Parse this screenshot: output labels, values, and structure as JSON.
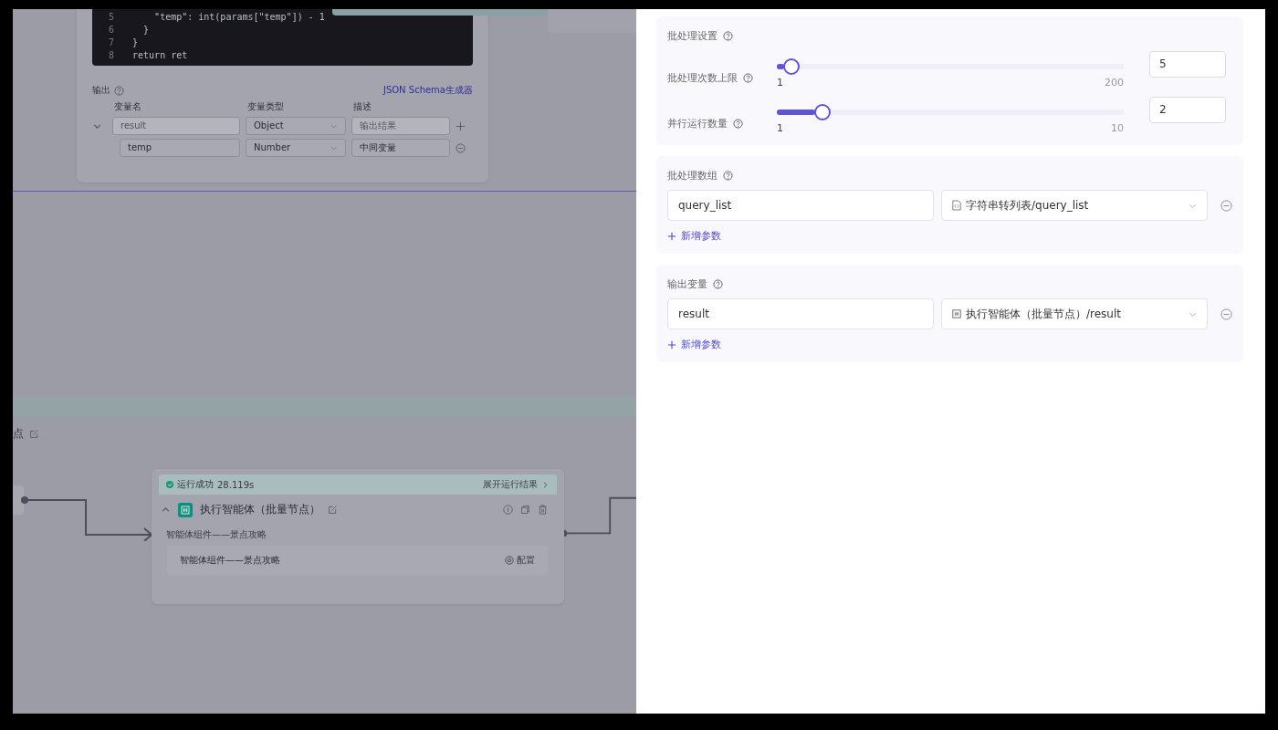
{
  "canvas": {
    "code_node": {
      "code_lines": [
        {
          "number": "5",
          "text": "      \"temp\": int(params[\"temp\"]) - 1"
        },
        {
          "number": "6",
          "text": "    }"
        },
        {
          "number": "7",
          "text": "  }"
        },
        {
          "number": "8",
          "text": "  return ret"
        }
      ],
      "output": {
        "label": "输出",
        "schema_link": "JSON Schema生成器",
        "columns": [
          "变量名",
          "变量类型",
          "描述"
        ],
        "rows": [
          {
            "kind": "object",
            "expanded": true,
            "disabled": true,
            "name": "result",
            "type": "Object",
            "description": "输出结果"
          },
          {
            "kind": "field",
            "disabled": false,
            "name": "temp",
            "type": "Number",
            "description": "中间变量"
          }
        ]
      }
    },
    "prev_node_title": "点",
    "batch_node": {
      "status": "运行成功",
      "time": "28.119s",
      "expand_link": "展开运行结果",
      "title": "执行智能体（批量节点）",
      "subtitle": "智能体组件——景点攻略",
      "component": {
        "name": "智能体组件——景点攻略",
        "action": "配置"
      }
    }
  },
  "panel": {
    "batch_settings": {
      "title": "批处理设置",
      "sliders": [
        {
          "label": "批处理次数上限",
          "level": 0.02,
          "min": "1",
          "max": "200",
          "value": "5"
        },
        {
          "label": "并行运行数量",
          "level": 0.11,
          "min": "1",
          "max": "10",
          "value": "2"
        }
      ]
    },
    "param_sections": [
      {
        "title": "批处理数组",
        "params": [
          {
            "name": "query_list",
            "kind": "code",
            "source": "字符串转列表/query_list"
          }
        ],
        "add_label": "新增参数"
      },
      {
        "title": "输出变量",
        "params": [
          {
            "name": "result",
            "kind": "agent",
            "source": "执行智能体（批量节点）/result"
          }
        ],
        "add_label": "新增参数"
      }
    ]
  }
}
